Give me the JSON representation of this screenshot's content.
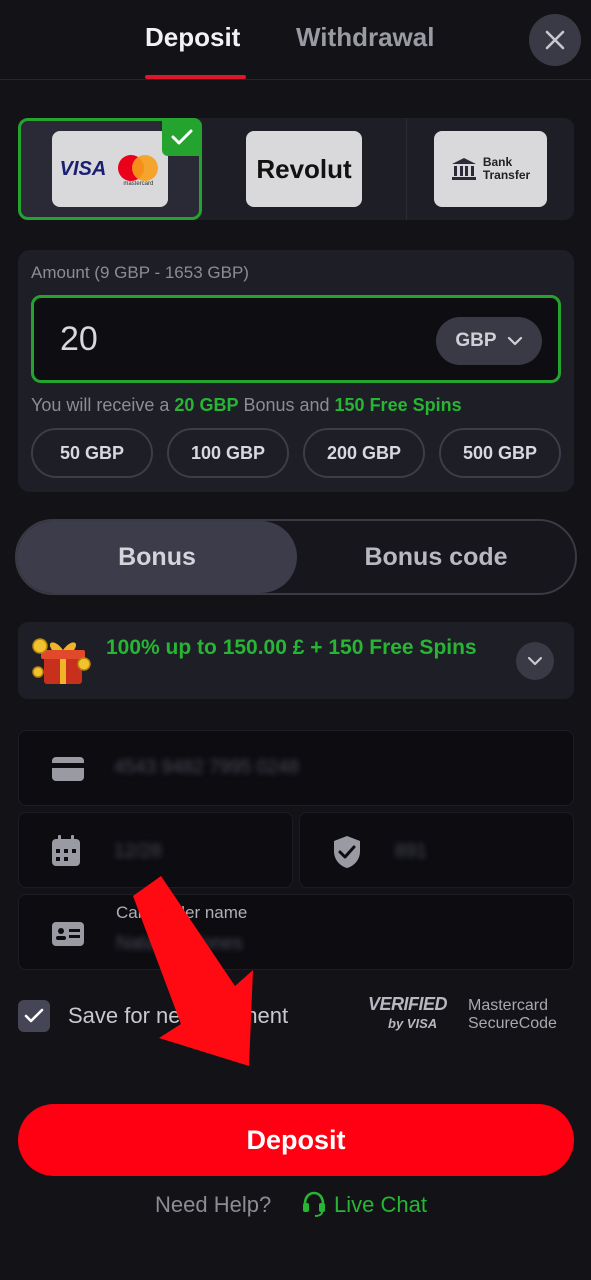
{
  "tabs": {
    "deposit": "Deposit",
    "withdrawal": "Withdrawal"
  },
  "payment_methods": {
    "visa": "VISA",
    "mastercard": "mastercard",
    "revolut": "Revolut",
    "bank_transfer_line1": "Bank",
    "bank_transfer_line2": "Transfer",
    "selected": "visa"
  },
  "amount": {
    "label": "Amount (9 GBP - 1653 GBP)",
    "value": "20",
    "currency": "GBP",
    "bonus_prefix": "You will receive a ",
    "bonus_amount": "20 GBP",
    "bonus_middle": " Bonus and ",
    "free_spins": "150 Free Spins",
    "presets": [
      "50 GBP",
      "100 GBP",
      "200 GBP",
      "500 GBP"
    ]
  },
  "bonus_toggle": {
    "bonus": "Bonus",
    "bonus_code": "Bonus code",
    "selected": "bonus"
  },
  "offer": {
    "text": "100% up to 150.00 £ + 150 Free Spins"
  },
  "card_fields": {
    "card_number": "4543 9482 7995 0248",
    "expiry": "12/28",
    "cvv": "891",
    "cardholder_label": "Cardholder name",
    "cardholder_value": "Natasha Jones"
  },
  "save": {
    "label": "Save for next payment",
    "checked": true
  },
  "badges": {
    "verified_line1": "VERIFIED",
    "verified_line2": "by VISA",
    "mc_line1": "Mastercard",
    "mc_line2": "SecureCode"
  },
  "deposit_button": "Deposit",
  "help": {
    "text": "Need Help?",
    "live_chat": "Live Chat"
  },
  "colors": {
    "accent_green": "#24a42f",
    "accent_red": "#ff0012",
    "background": "#121217"
  }
}
